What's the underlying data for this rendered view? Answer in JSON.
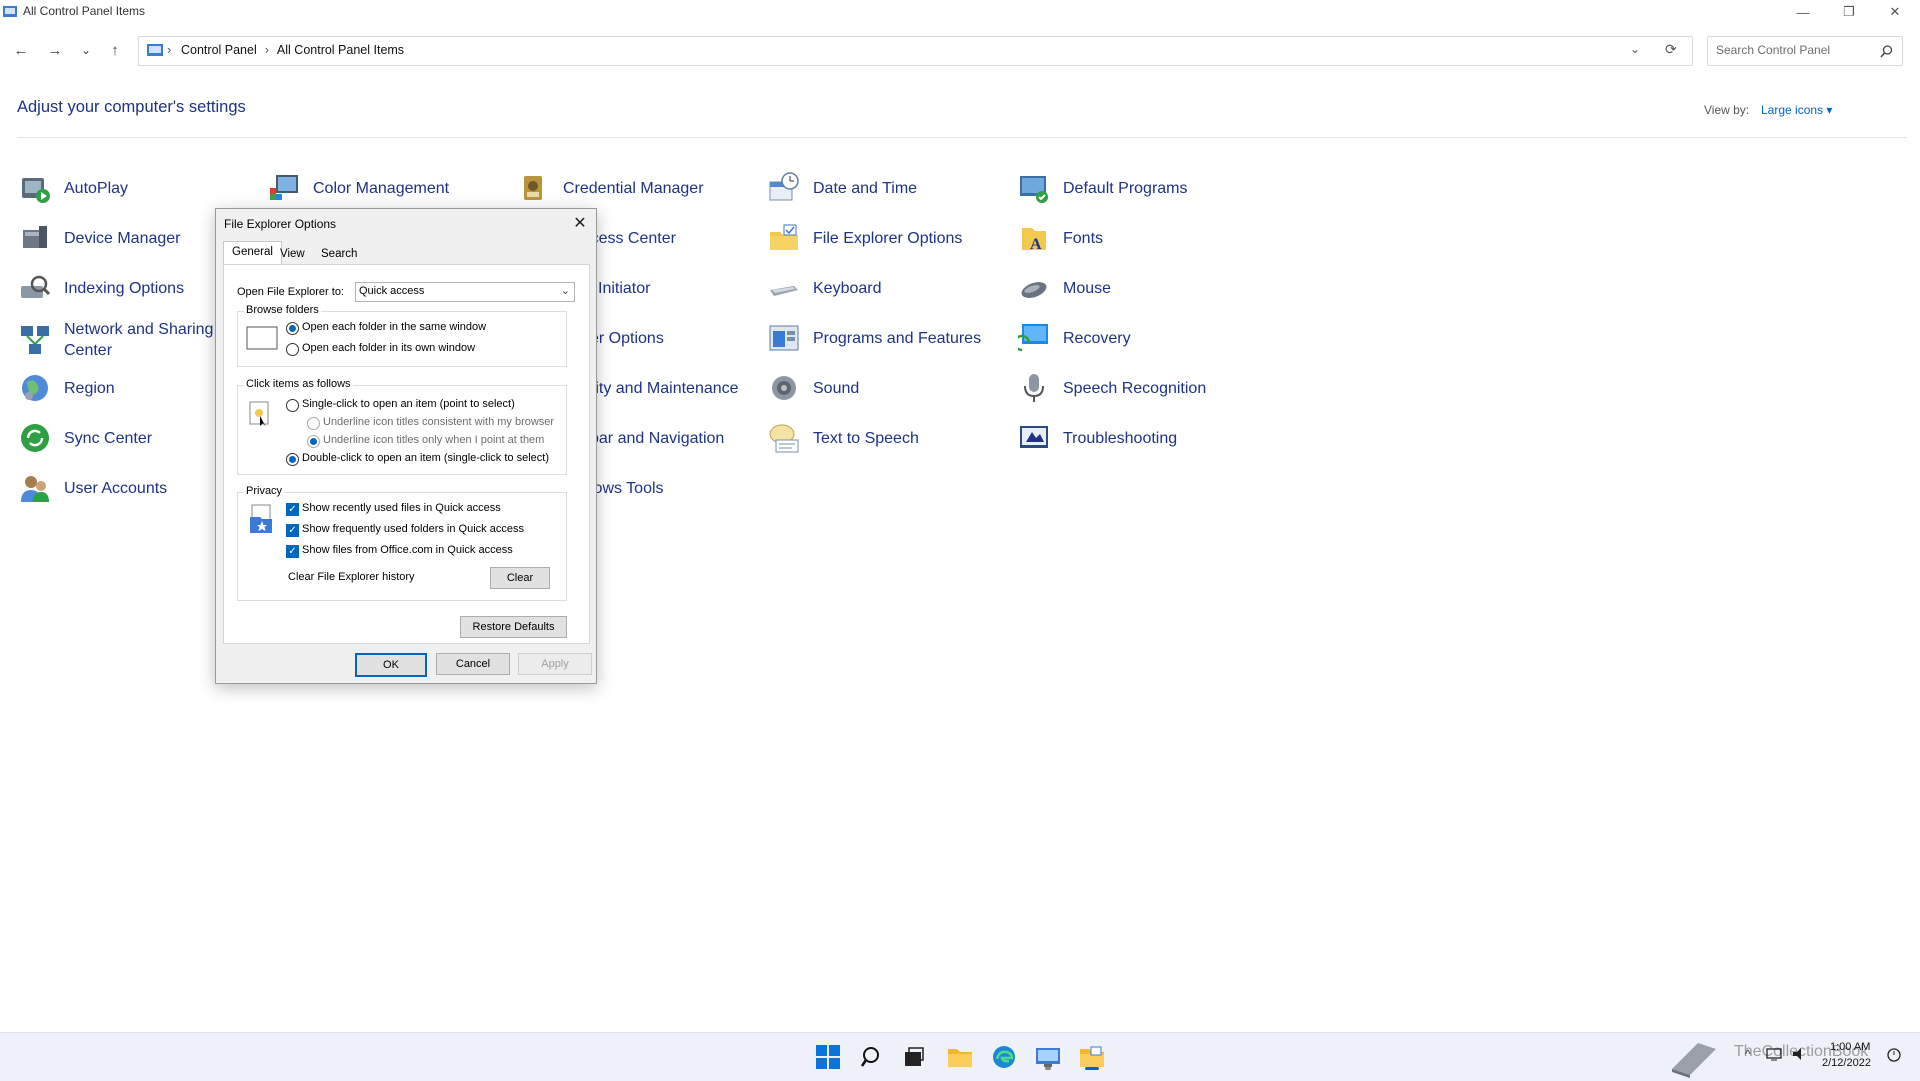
{
  "window": {
    "title": "All Control Panel Items",
    "minimize": "—",
    "maximize": "❐",
    "close": "✕"
  },
  "nav": {
    "back": "←",
    "forward": "→",
    "recent": "⌄",
    "up": "↑",
    "breadcrumb": [
      "Control Panel",
      "All Control Panel Items"
    ],
    "separator": "›",
    "dropdown": "⌄",
    "refresh": "⟳",
    "search_placeholder": "Search Control Panel"
  },
  "header": {
    "title": "Adjust your computer's settings",
    "view_by_label": "View by:",
    "view_by_value": "Large icons ▾"
  },
  "items": [
    {
      "label": "AutoPlay",
      "icon": "autoplay-icon"
    },
    {
      "label": "Color Management",
      "icon": "color-management-icon"
    },
    {
      "label": "Credential Manager",
      "icon": "credential-manager-icon"
    },
    {
      "label": "Date and Time",
      "icon": "date-time-icon"
    },
    {
      "label": "Default Programs",
      "icon": "default-programs-icon"
    },
    {
      "label": "Device Manager",
      "icon": "device-manager-icon"
    },
    {
      "label": "of Access Center",
      "icon": "ease-of-access-icon"
    },
    {
      "label": "File Explorer Options",
      "icon": "file-explorer-options-icon"
    },
    {
      "label": "Fonts",
      "icon": "fonts-icon"
    },
    {
      "label": "Indexing Options",
      "icon": "indexing-options-icon"
    },
    {
      "label": "l Initiator",
      "icon": "iscsi-initiator-icon"
    },
    {
      "label": "Keyboard",
      "icon": "keyboard-icon"
    },
    {
      "label": "Mouse",
      "icon": "mouse-icon"
    },
    {
      "label": "Network and Sharing Center",
      "icon": "network-sharing-icon"
    },
    {
      "label": "er Options",
      "icon": "power-options-icon"
    },
    {
      "label": "Programs and Features",
      "icon": "programs-features-icon"
    },
    {
      "label": "Recovery",
      "icon": "recovery-icon"
    },
    {
      "label": "Region",
      "icon": "region-icon"
    },
    {
      "label": "rity and Maintenance",
      "icon": "security-maintenance-icon"
    },
    {
      "label": "Sound",
      "icon": "sound-icon"
    },
    {
      "label": "Speech Recognition",
      "icon": "speech-recognition-icon"
    },
    {
      "label": "Sync Center",
      "icon": "sync-center-icon"
    },
    {
      "label": "bar and Navigation",
      "icon": "taskbar-navigation-icon"
    },
    {
      "label": "Text to Speech",
      "icon": "text-to-speech-icon"
    },
    {
      "label": "Troubleshooting",
      "icon": "troubleshooting-icon"
    },
    {
      "label": "User Accounts",
      "icon": "user-accounts-icon"
    },
    {
      "label": "lows Tools",
      "icon": "windows-tools-icon"
    }
  ],
  "dialog": {
    "title": "File Explorer Options",
    "close": "✕",
    "tabs": [
      "General",
      "View",
      "Search"
    ],
    "open_to_label": "Open File Explorer to:",
    "open_to_value": "Quick access",
    "browse_legend": "Browse folders",
    "browse_same": "Open each folder in the same window",
    "browse_own": "Open each folder in its own window",
    "click_legend": "Click items as follows",
    "single_click": "Single-click to open an item (point to select)",
    "underline_browser": "Underline icon titles consistent with my browser",
    "underline_point": "Underline icon titles only when I point at them",
    "double_click": "Double-click to open an item (single-click to select)",
    "privacy_legend": "Privacy",
    "recent_files": "Show recently used files in Quick access",
    "frequent_folders": "Show frequently used folders in Quick access",
    "office_files": "Show files from Office.com in Quick access",
    "clear_history_label": "Clear File Explorer history",
    "clear_button": "Clear",
    "restore_button": "Restore Defaults",
    "ok": "OK",
    "cancel": "Cancel",
    "apply": "Apply",
    "check": "✓"
  },
  "taskbar": {
    "time": "1:00 AM",
    "date": "2/12/2022",
    "watermark": "TheCollectionBook"
  }
}
